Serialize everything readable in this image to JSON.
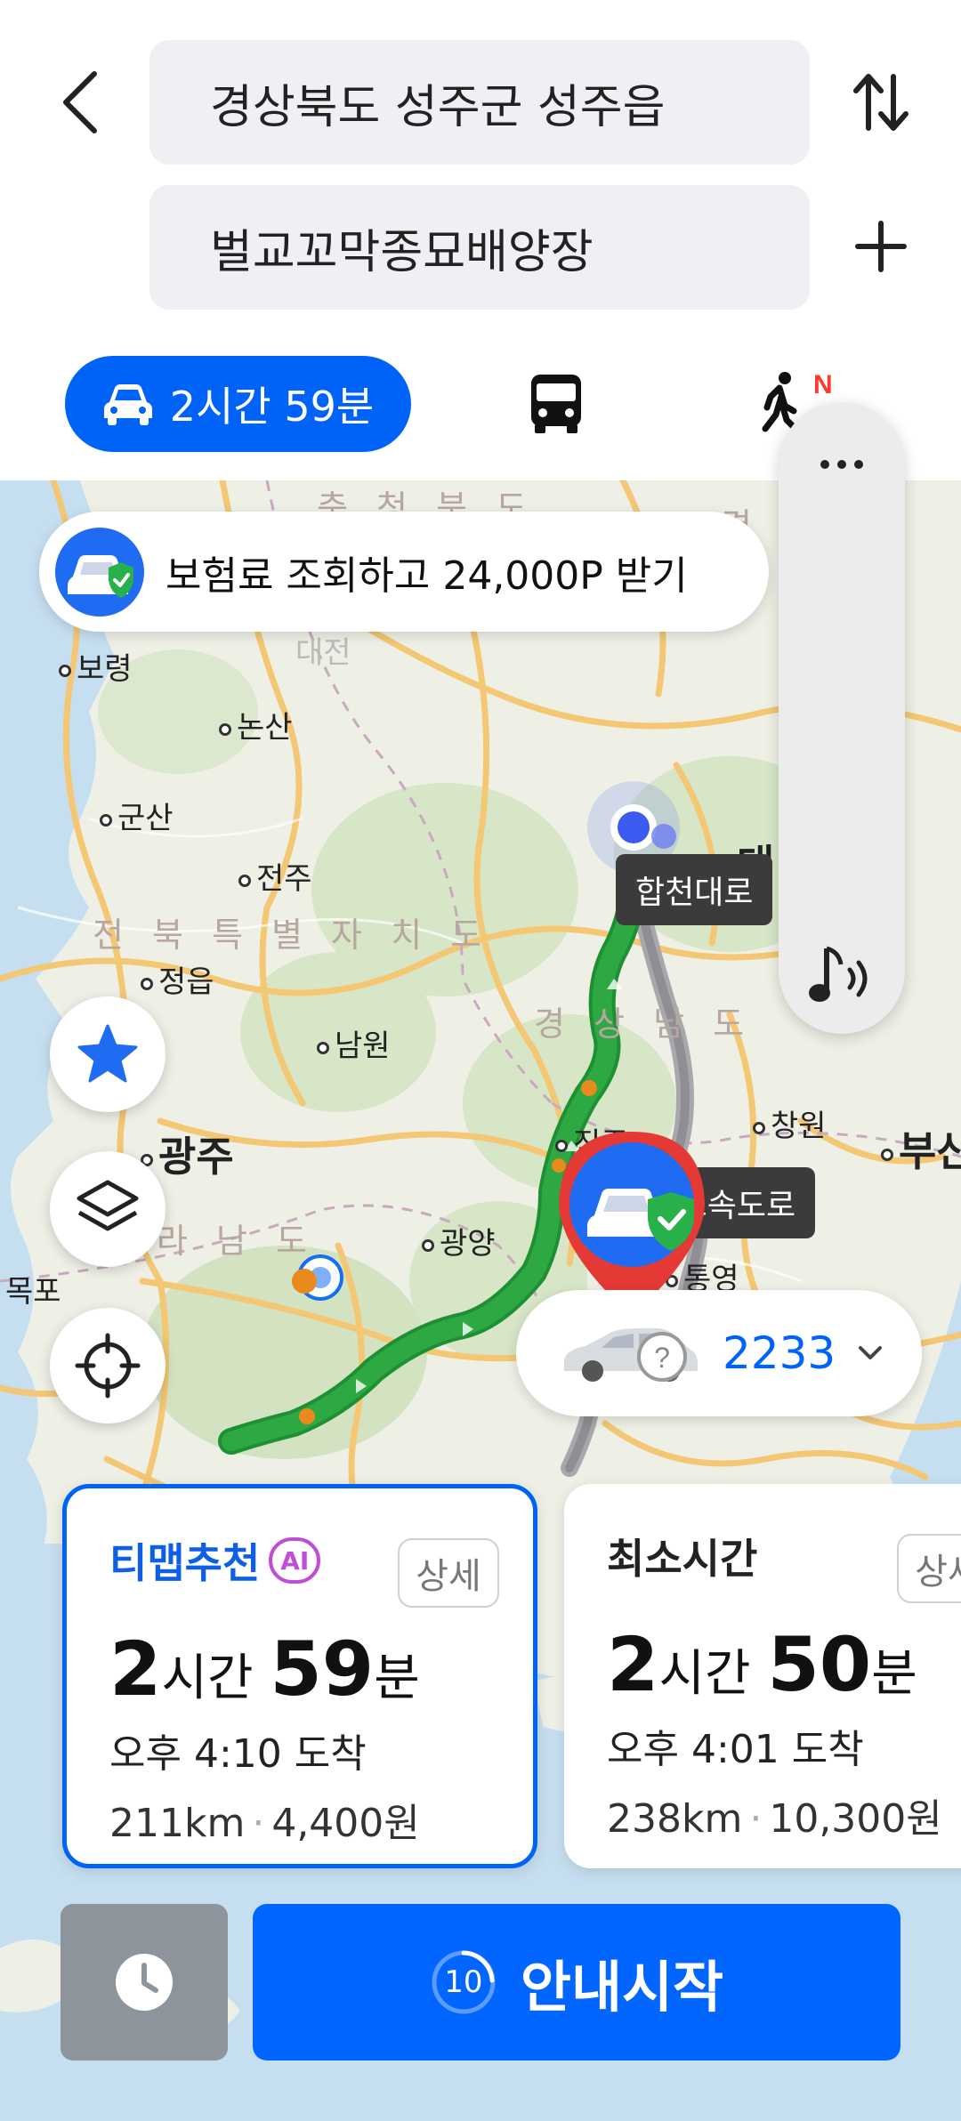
{
  "search": {
    "origin": "경상북도 성주군 성주읍",
    "destination": "벌교꼬막종묘배양장"
  },
  "modes": {
    "car_time": "2시간 59분",
    "walk_badge": "N"
  },
  "banner": {
    "text": "보험료 조회하고 24,000P 받기"
  },
  "map": {
    "labels": {
      "chungbuk": "충 청 북 도",
      "daejeon": "대전",
      "boryeong": "보령",
      "nonsan": "논산",
      "gunsan": "군산",
      "jeonju": "전주",
      "jeonbuk": "전 북 특 별 자 치 도",
      "jeongeup": "정읍",
      "namwon": "남원",
      "gwangju": "광주",
      "jeonnam": "라 남 도",
      "mokpo": "목포",
      "gwangyang": "광양",
      "jinju": "진주",
      "gyeongnam": "경 상 남 도",
      "changwon": "창원",
      "busan": "부산",
      "tongyeong": "통영",
      "daegu": "대",
      "gyeongbuk": "경 상"
    },
    "road_tags": {
      "hapcheon": "합천대로",
      "namhae": "남해 고속도로"
    },
    "arrival": "도착"
  },
  "vehicle": {
    "number": "2233"
  },
  "routes": [
    {
      "title": "티맵추천",
      "ai": "AI",
      "detail": "상세",
      "hours": "2",
      "hours_unit": "시간",
      "minutes": "59",
      "minutes_unit": "분",
      "eta": "오후 4:10 도착",
      "distance": "211km",
      "toll": "4,400원"
    },
    {
      "title": "최소시간",
      "detail": "상세",
      "hours": "2",
      "hours_unit": "시간",
      "minutes": "50",
      "minutes_unit": "분",
      "eta": "오후 4:01 도착",
      "distance": "238km",
      "toll": "10,300원"
    }
  ],
  "bottom": {
    "countdown": "10",
    "start_label": "안내시작"
  },
  "colors": {
    "accent": "#0063f7",
    "route_green": "#2ea843",
    "route_gray": "#8e8e93",
    "pin_red": "#e53935"
  }
}
